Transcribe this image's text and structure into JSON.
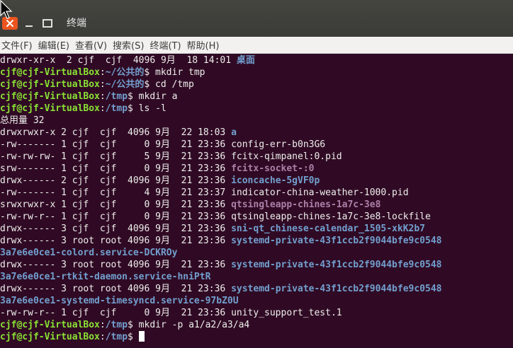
{
  "window": {
    "title": "终端"
  },
  "menu": [
    "文件(F)",
    "编辑(E)",
    "查看(V)",
    "搜索(S)",
    "终端(T)",
    "帮助(H)"
  ],
  "colors": {
    "background": "#300a24",
    "prompt_user": "#8ae234",
    "prompt_path": "#729fcf",
    "directory": "#729fcf",
    "socket": "#ad7fa8",
    "close_button": "#e9541f"
  },
  "icons": [
    "close-icon",
    "minimize-icon",
    "maximize-icon",
    "mouse-pointer-icon"
  ],
  "terminal": {
    "lines": [
      {
        "type": "output",
        "segments": [
          {
            "t": "drwxr-xr-x  2 cjf  cjf  4096 9月  18 14:01 ",
            "c": "plain"
          },
          {
            "t": "桌面",
            "c": "dir"
          }
        ]
      },
      {
        "type": "prompt",
        "segments": [
          {
            "t": "cjf@cjf-VirtualBox",
            "c": "user"
          },
          {
            "t": ":",
            "c": "plain"
          },
          {
            "t": "~/公共的",
            "c": "path"
          },
          {
            "t": "$ mkdir tmp",
            "c": "plain"
          }
        ]
      },
      {
        "type": "prompt",
        "segments": [
          {
            "t": "cjf@cjf-VirtualBox",
            "c": "user"
          },
          {
            "t": ":",
            "c": "plain"
          },
          {
            "t": "~/公共的",
            "c": "path"
          },
          {
            "t": "$ cd /tmp",
            "c": "plain"
          }
        ]
      },
      {
        "type": "prompt",
        "segments": [
          {
            "t": "cjf@cjf-VirtualBox",
            "c": "user"
          },
          {
            "t": ":",
            "c": "plain"
          },
          {
            "t": "/tmp",
            "c": "path"
          },
          {
            "t": "$ mkdir a",
            "c": "plain"
          }
        ]
      },
      {
        "type": "prompt",
        "segments": [
          {
            "t": "cjf@cjf-VirtualBox",
            "c": "user"
          },
          {
            "t": ":",
            "c": "plain"
          },
          {
            "t": "/tmp",
            "c": "path"
          },
          {
            "t": "$ ls -l",
            "c": "plain"
          }
        ]
      },
      {
        "type": "output",
        "segments": [
          {
            "t": "总用量 32",
            "c": "plain"
          }
        ]
      },
      {
        "type": "output",
        "segments": [
          {
            "t": "drwxrwxr-x 2 cjf  cjf  4096 9月  22 18:03 ",
            "c": "plain"
          },
          {
            "t": "a",
            "c": "dir"
          }
        ]
      },
      {
        "type": "output",
        "segments": [
          {
            "t": "-rw------- 1 cjf  cjf     0 9月  21 23:36 config-err-b0n3G6",
            "c": "plain"
          }
        ]
      },
      {
        "type": "output",
        "segments": [
          {
            "t": "-rw-rw-rw- 1 cjf  cjf     5 9月  21 23:36 fcitx-qimpanel:0.pid",
            "c": "plain"
          }
        ]
      },
      {
        "type": "output",
        "segments": [
          {
            "t": "srw------- 1 cjf  cjf     0 9月  21 23:36 ",
            "c": "plain"
          },
          {
            "t": "fcitx-socket-:0",
            "c": "sock"
          }
        ]
      },
      {
        "type": "output",
        "segments": [
          {
            "t": "drwx------ 2 cjf  cjf  4096 9月  21 23:36 ",
            "c": "plain"
          },
          {
            "t": "iconcache-5gVF0p",
            "c": "dir"
          }
        ]
      },
      {
        "type": "output",
        "segments": [
          {
            "t": "-rw------- 1 cjf  cjf     4 9月  21 23:37 indicator-china-weather-1000.pid",
            "c": "plain"
          }
        ]
      },
      {
        "type": "output",
        "segments": [
          {
            "t": "srwxrwxr-x 1 cjf  cjf     0 9月  21 23:36 ",
            "c": "plain"
          },
          {
            "t": "qtsingleapp-chines-1a7c-3e8",
            "c": "sock"
          }
        ]
      },
      {
        "type": "output",
        "segments": [
          {
            "t": "-rw-rw-r-- 1 cjf  cjf     0 9月  21 23:36 qtsingleapp-chines-1a7c-3e8-lockfile",
            "c": "plain"
          }
        ]
      },
      {
        "type": "output",
        "segments": [
          {
            "t": "drwx------ 3 cjf  cjf  4096 9月  21 23:36 ",
            "c": "plain"
          },
          {
            "t": "sni-qt_chinese-calendar_1505-xkK2b7",
            "c": "dir"
          }
        ]
      },
      {
        "type": "output",
        "segments": [
          {
            "t": "drwx------ 3 root root 4096 9月  21 23:36 ",
            "c": "plain"
          },
          {
            "t": "systemd-private-43f1ccb2f9044bfe9c0548",
            "c": "dir"
          }
        ]
      },
      {
        "type": "output",
        "segments": [
          {
            "t": "3a7e6e0ce1-colord.service-DCKROy",
            "c": "dir"
          }
        ]
      },
      {
        "type": "output",
        "segments": [
          {
            "t": "drwx------ 3 root root 4096 9月  21 23:36 ",
            "c": "plain"
          },
          {
            "t": "systemd-private-43f1ccb2f9044bfe9c0548",
            "c": "dir"
          }
        ]
      },
      {
        "type": "output",
        "segments": [
          {
            "t": "3a7e6e0ce1-rtkit-daemon.service-hniPtR",
            "c": "dir"
          }
        ]
      },
      {
        "type": "output",
        "segments": [
          {
            "t": "drwx------ 3 root root 4096 9月  21 23:36 ",
            "c": "plain"
          },
          {
            "t": "systemd-private-43f1ccb2f9044bfe9c0548",
            "c": "dir"
          }
        ]
      },
      {
        "type": "output",
        "segments": [
          {
            "t": "3a7e6e0ce1-systemd-timesyncd.service-97bZ0U",
            "c": "dir"
          }
        ]
      },
      {
        "type": "output",
        "segments": [
          {
            "t": "-rw-rw-r-- 1 cjf  cjf     0 9月  21 23:36 unity_support_test.1",
            "c": "plain"
          }
        ]
      },
      {
        "type": "prompt",
        "segments": [
          {
            "t": "cjf@cjf-VirtualBox",
            "c": "user"
          },
          {
            "t": ":",
            "c": "plain"
          },
          {
            "t": "/tmp",
            "c": "path"
          },
          {
            "t": "$ mkdir -p a1/a2/a3/a4",
            "c": "plain"
          }
        ]
      },
      {
        "type": "prompt",
        "cursor": true,
        "segments": [
          {
            "t": "cjf@cjf-VirtualBox",
            "c": "user"
          },
          {
            "t": ":",
            "c": "plain"
          },
          {
            "t": "/tmp",
            "c": "path"
          },
          {
            "t": "$ ",
            "c": "plain"
          }
        ]
      }
    ]
  }
}
